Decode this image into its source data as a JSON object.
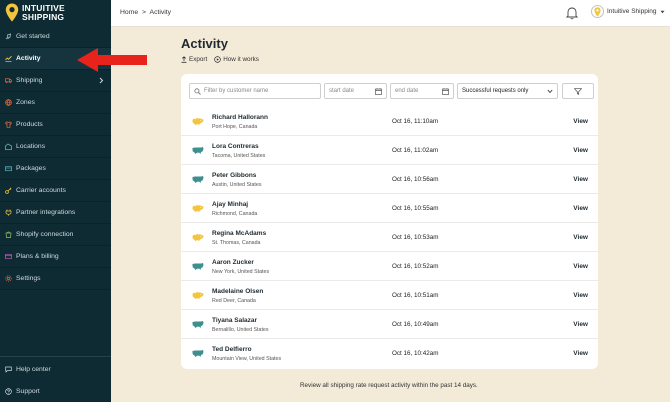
{
  "brand": {
    "line1": "INTUITIVE",
    "line2": "SHIPPING"
  },
  "sidebar": {
    "items": [
      {
        "label": "Get started",
        "icon": "rocket-icon"
      },
      {
        "label": "Activity",
        "icon": "activity-chart-icon",
        "active": true
      },
      {
        "label": "Shipping",
        "icon": "truck-icon",
        "has_submenu": true
      },
      {
        "label": "Zones",
        "icon": "globe-icon"
      },
      {
        "label": "Products",
        "icon": "shirt-icon"
      },
      {
        "label": "Locations",
        "icon": "building-icon"
      },
      {
        "label": "Packages",
        "icon": "package-icon"
      },
      {
        "label": "Carrier accounts",
        "icon": "key-icon"
      },
      {
        "label": "Partner integrations",
        "icon": "plug-icon"
      },
      {
        "label": "Shopify connection",
        "icon": "shopify-icon"
      },
      {
        "label": "Plans & billing",
        "icon": "credit-card-icon"
      },
      {
        "label": "Settings",
        "icon": "gear-icon"
      }
    ],
    "footer": [
      {
        "label": "Help center",
        "icon": "chat-icon"
      },
      {
        "label": "Support",
        "icon": "question-icon"
      }
    ]
  },
  "topbar": {
    "breadcrumb_home": "Home",
    "breadcrumb_sep": ">",
    "breadcrumb_current": "Activity",
    "account_name": "Intuitive Shipping"
  },
  "page": {
    "title": "Activity",
    "export_label": "Export",
    "how_label": "How it works"
  },
  "filters": {
    "search_placeholder": "Filter by customer name",
    "start_placeholder": "start date",
    "end_placeholder": "end date",
    "status_value": "Successful requests only"
  },
  "rows": [
    {
      "name": "Richard Hallorann",
      "location": "Port Hope, Canada",
      "time": "Oct 16, 11:10am",
      "country": "ca",
      "action": "View"
    },
    {
      "name": "Lora Contreras",
      "location": "Tacoma, United States",
      "time": "Oct 16, 11:02am",
      "country": "us",
      "action": "View"
    },
    {
      "name": "Peter Gibbons",
      "location": "Austin, United States",
      "time": "Oct 16, 10:56am",
      "country": "us",
      "action": "View"
    },
    {
      "name": "Ajay Minhaj",
      "location": "Richmond, Canada",
      "time": "Oct 16, 10:55am",
      "country": "ca",
      "action": "View"
    },
    {
      "name": "Regina McAdams",
      "location": "St. Thomas, Canada",
      "time": "Oct 16, 10:53am",
      "country": "ca",
      "action": "View"
    },
    {
      "name": "Aaron Zucker",
      "location": "New York, United States",
      "time": "Oct 16, 10:52am",
      "country": "us",
      "action": "View"
    },
    {
      "name": "Madelaine Olsen",
      "location": "Red Deer, Canada",
      "time": "Oct 16, 10:51am",
      "country": "ca",
      "action": "View"
    },
    {
      "name": "Tiyana Salazar",
      "location": "Bernalillo, United States",
      "time": "Oct 16, 10:49am",
      "country": "us",
      "action": "View"
    },
    {
      "name": "Ted Delfierro",
      "location": "Mountain View, United States",
      "time": "Oct 16, 10:42am",
      "country": "us",
      "action": "View"
    }
  ],
  "footer_note": "Review all shipping rate request activity within the past 14 days.",
  "colors": {
    "sidebar": "#0e2a33",
    "background": "#f3ead8",
    "canada": "#f2c53d",
    "usa": "#3f8f8f",
    "arrow": "#e8231b"
  }
}
